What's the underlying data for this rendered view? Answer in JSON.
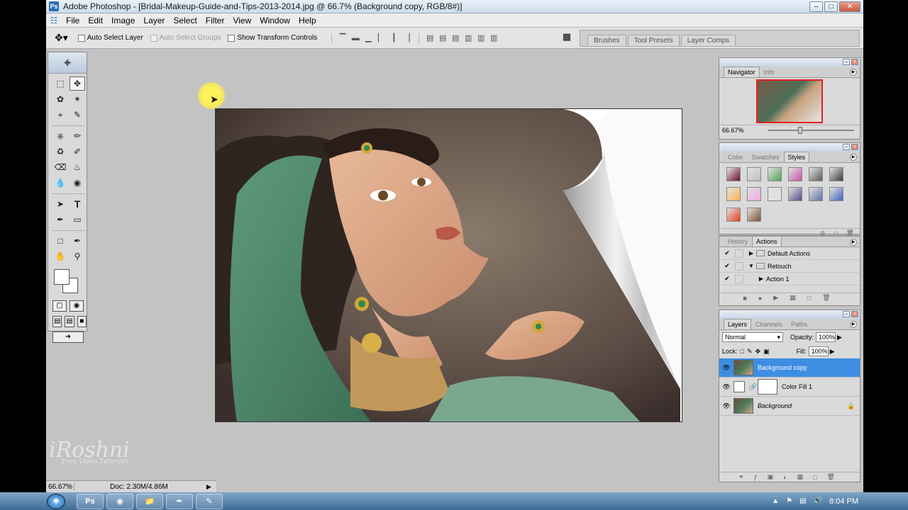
{
  "window": {
    "title": "Adobe Photoshop - [Bridal-Makeup-Guide-and-Tips-2013-2014.jpg @ 66.7% (Background copy, RGB/8#)]"
  },
  "menubar": [
    "File",
    "Edit",
    "Image",
    "Layer",
    "Select",
    "Filter",
    "View",
    "Window",
    "Help"
  ],
  "options": {
    "auto_select_layer": "Auto Select Layer",
    "auto_select_groups": "Auto Select Groups",
    "show_transform_controls": "Show Transform Controls"
  },
  "palette_well": [
    "Brushes",
    "Tool Presets",
    "Layer Comps"
  ],
  "status": {
    "zoom": "66.67%",
    "doc_size": "Doc: 2.30M/4.86M"
  },
  "watermark": {
    "brand": "iRoshni",
    "tagline": "Free Video Tutorials"
  },
  "navigator": {
    "tabs": [
      "Navigator",
      "Info"
    ],
    "zoom": "66.67%"
  },
  "styles_palette": {
    "tabs": [
      "Color",
      "Swatches",
      "Styles"
    ],
    "swatch_colors": [
      "#6a1020",
      "#c0c0c0",
      "#4fa05a",
      "#c94fa8",
      "#5a5a5a",
      "#3a3a3a",
      "#ffb050",
      "#f0a8e0",
      "#e0e0e0",
      "#5a4a8a",
      "#6070a0",
      "#4060c0",
      "#e04020",
      "#7a5030"
    ]
  },
  "actions_palette": {
    "tabs": [
      "History",
      "Actions"
    ],
    "rows": [
      {
        "label": "Default Actions"
      },
      {
        "label": "Retouch"
      },
      {
        "label": "Action 1"
      }
    ]
  },
  "layers_palette": {
    "tabs": [
      "Layers",
      "Channels",
      "Paths"
    ],
    "blend_mode": "Normal",
    "opacity_label": "Opacity:",
    "opacity": "100%",
    "lock_label": "Lock:",
    "fill_label": "Fill:",
    "fill": "100%",
    "layers": [
      {
        "name": "Background copy"
      },
      {
        "name": "Color Fill 1"
      },
      {
        "name": "Background"
      }
    ]
  },
  "taskbar": {
    "clock": "8:04 PM"
  }
}
